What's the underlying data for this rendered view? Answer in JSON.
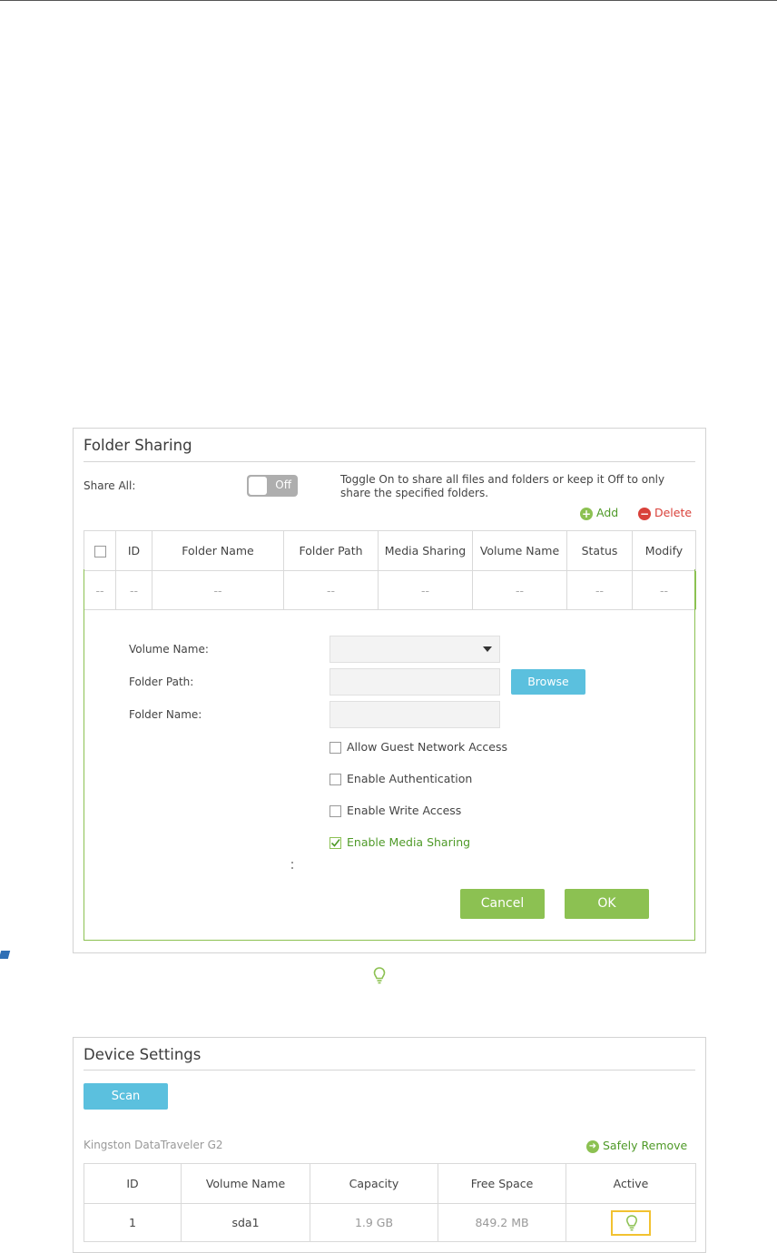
{
  "folder_sharing": {
    "title": "Folder Sharing",
    "share_all_label": "Share All:",
    "toggle_label": "Off",
    "toggle_hint": "Toggle On to share all files and folders or keep it Off to only share the specified folders.",
    "add_label": "Add",
    "delete_label": "Delete",
    "columns": [
      "ID",
      "Folder Name",
      "Folder Path",
      "Media Sharing",
      "Volume Name",
      "Status",
      "Modify"
    ],
    "empty_row": [
      "--",
      "--",
      "--",
      "--",
      "--",
      "--",
      "--",
      "--"
    ],
    "form": {
      "volume_name_label": "Volume Name:",
      "folder_path_label": "Folder Path:",
      "folder_name_label": "Folder Name:",
      "browse_label": "Browse",
      "options": [
        {
          "label": "Allow Guest Network Access",
          "checked": false
        },
        {
          "label": "Enable Authentication",
          "checked": false
        },
        {
          "label": "Enable Write Access",
          "checked": false
        },
        {
          "label": "Enable Media Sharing",
          "checked": true
        }
      ],
      "cancel_label": "Cancel",
      "ok_label": "OK"
    }
  },
  "device_settings": {
    "title": "Device Settings",
    "scan_label": "Scan",
    "device_name": "Kingston DataTraveler G2",
    "safely_remove_label": "Safely Remove",
    "columns": [
      "ID",
      "Volume Name",
      "Capacity",
      "Free Space",
      "Active"
    ],
    "rows": [
      {
        "id": "1",
        "volume_name": "sda1",
        "capacity": "1.9 GB",
        "free_space": "849.2 MB"
      }
    ]
  },
  "colors": {
    "green": "#8cc152",
    "green_text": "#4f9a28",
    "red": "#d9413a",
    "blue_button": "#5bc0de",
    "highlight": "#f2c230"
  },
  "icons": [
    "add-icon",
    "delete-icon",
    "dropdown-arrow-icon",
    "lightbulb-icon",
    "safely-remove-icon",
    "checkbox-icon"
  ]
}
